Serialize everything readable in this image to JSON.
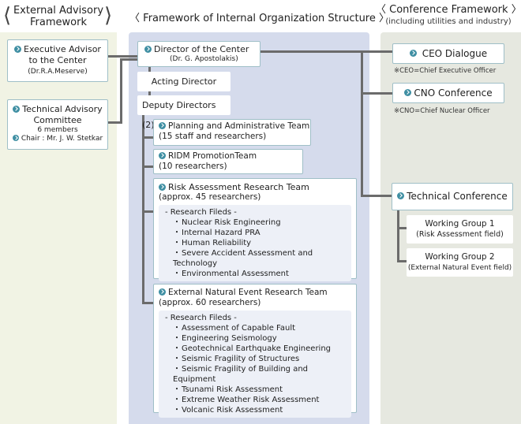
{
  "headers": {
    "external": {
      "line1": "External Advisory",
      "line2": "Framework"
    },
    "internal": {
      "title": "Framework of Internal Organization Structure"
    },
    "conference": {
      "title": "Conference Framework",
      "subtitle": "(including utilities and industry)"
    }
  },
  "external": {
    "executive_advisor": {
      "line1": "Executive Advisor",
      "line2": "to the Center",
      "name": "(Dr.R.A.Meserve)"
    },
    "technical_committee": {
      "line1": "Technical Advisory",
      "line2": "Committee",
      "members": "6 members",
      "chair": "Chair : Mr. J. W. Stetkar"
    }
  },
  "internal": {
    "director": {
      "title": "Director of the Center",
      "name": "(Dr. G. Apostolakis)"
    },
    "acting_director": "Acting Director",
    "deputy_directors": "Deputy Directors (2)",
    "teams": [
      {
        "title": "Planning and Administrative Team",
        "size": "(15 staff and researchers)"
      },
      {
        "title": "RIDM PromotionTeam",
        "size": "(10 researchers)"
      },
      {
        "title": "Risk Assessment Research Team",
        "size": "(approx. 45 researchers)",
        "fields_label": "- Research Fileds -",
        "fields": [
          "Nuclear Risk Engineering",
          "Internal Hazard PRA",
          "Human Reliability",
          "Severe Accident Assessment and Technology",
          "Environmental Assessment"
        ]
      },
      {
        "title": "External Natural Event Research Team",
        "size": "(approx. 60 researchers)",
        "fields_label": "- Research Fileds -",
        "fields": [
          "Assessment of Capable Fault",
          "Engineering Seismology",
          "Geotechnical Earthquake Engineering",
          "Seismic Fragility of Structures",
          "Seismic Fragility of Building and Equipment",
          "Tsunami Risk Assessment",
          "Extreme Weather Risk Assessment",
          "Volcanic Risk Assessment"
        ]
      }
    ]
  },
  "conference": {
    "ceo": {
      "title": "CEO Dialogue",
      "note": "※CEO=Chief Executive Officer"
    },
    "cno": {
      "title": "CNO Conference",
      "note": "※CNO=Chief Nuclear Officer"
    },
    "technical": {
      "title": "Technical Conference"
    },
    "wg1": {
      "title": "Working Group 1",
      "field": "(Risk Assessment field)"
    },
    "wg2": {
      "title": "Working Group 2",
      "field": "(External Natural Event field)"
    }
  },
  "colors": {
    "accent": "#3f8fa3",
    "connector": "#6b6b6b",
    "left_panel": "#f1f3e4",
    "mid_panel": "#d5dbec",
    "right_panel": "#e6e8e0"
  }
}
